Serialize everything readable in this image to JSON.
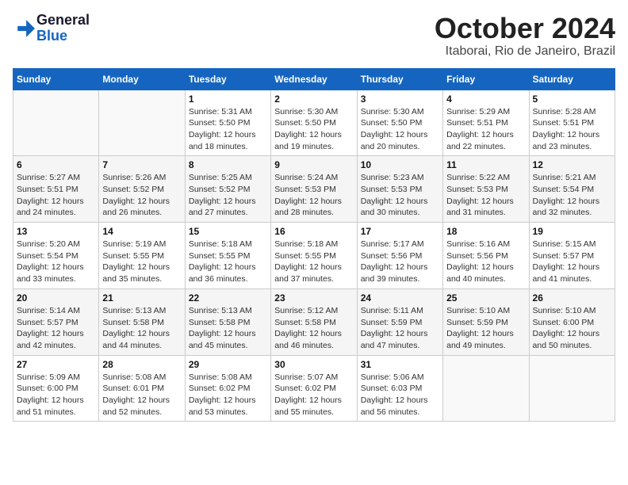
{
  "logo": {
    "line1": "General",
    "line2": "Blue"
  },
  "header": {
    "month": "October 2024",
    "location": "Itaborai, Rio de Janeiro, Brazil"
  },
  "weekdays": [
    "Sunday",
    "Monday",
    "Tuesday",
    "Wednesday",
    "Thursday",
    "Friday",
    "Saturday"
  ],
  "weeks": [
    [
      {
        "day": "",
        "sunrise": "",
        "sunset": "",
        "daylight": ""
      },
      {
        "day": "",
        "sunrise": "",
        "sunset": "",
        "daylight": ""
      },
      {
        "day": "1",
        "sunrise": "Sunrise: 5:31 AM",
        "sunset": "Sunset: 5:50 PM",
        "daylight": "Daylight: 12 hours and 18 minutes."
      },
      {
        "day": "2",
        "sunrise": "Sunrise: 5:30 AM",
        "sunset": "Sunset: 5:50 PM",
        "daylight": "Daylight: 12 hours and 19 minutes."
      },
      {
        "day": "3",
        "sunrise": "Sunrise: 5:30 AM",
        "sunset": "Sunset: 5:50 PM",
        "daylight": "Daylight: 12 hours and 20 minutes."
      },
      {
        "day": "4",
        "sunrise": "Sunrise: 5:29 AM",
        "sunset": "Sunset: 5:51 PM",
        "daylight": "Daylight: 12 hours and 22 minutes."
      },
      {
        "day": "5",
        "sunrise": "Sunrise: 5:28 AM",
        "sunset": "Sunset: 5:51 PM",
        "daylight": "Daylight: 12 hours and 23 minutes."
      }
    ],
    [
      {
        "day": "6",
        "sunrise": "Sunrise: 5:27 AM",
        "sunset": "Sunset: 5:51 PM",
        "daylight": "Daylight: 12 hours and 24 minutes."
      },
      {
        "day": "7",
        "sunrise": "Sunrise: 5:26 AM",
        "sunset": "Sunset: 5:52 PM",
        "daylight": "Daylight: 12 hours and 26 minutes."
      },
      {
        "day": "8",
        "sunrise": "Sunrise: 5:25 AM",
        "sunset": "Sunset: 5:52 PM",
        "daylight": "Daylight: 12 hours and 27 minutes."
      },
      {
        "day": "9",
        "sunrise": "Sunrise: 5:24 AM",
        "sunset": "Sunset: 5:53 PM",
        "daylight": "Daylight: 12 hours and 28 minutes."
      },
      {
        "day": "10",
        "sunrise": "Sunrise: 5:23 AM",
        "sunset": "Sunset: 5:53 PM",
        "daylight": "Daylight: 12 hours and 30 minutes."
      },
      {
        "day": "11",
        "sunrise": "Sunrise: 5:22 AM",
        "sunset": "Sunset: 5:53 PM",
        "daylight": "Daylight: 12 hours and 31 minutes."
      },
      {
        "day": "12",
        "sunrise": "Sunrise: 5:21 AM",
        "sunset": "Sunset: 5:54 PM",
        "daylight": "Daylight: 12 hours and 32 minutes."
      }
    ],
    [
      {
        "day": "13",
        "sunrise": "Sunrise: 5:20 AM",
        "sunset": "Sunset: 5:54 PM",
        "daylight": "Daylight: 12 hours and 33 minutes."
      },
      {
        "day": "14",
        "sunrise": "Sunrise: 5:19 AM",
        "sunset": "Sunset: 5:55 PM",
        "daylight": "Daylight: 12 hours and 35 minutes."
      },
      {
        "day": "15",
        "sunrise": "Sunrise: 5:18 AM",
        "sunset": "Sunset: 5:55 PM",
        "daylight": "Daylight: 12 hours and 36 minutes."
      },
      {
        "day": "16",
        "sunrise": "Sunrise: 5:18 AM",
        "sunset": "Sunset: 5:55 PM",
        "daylight": "Daylight: 12 hours and 37 minutes."
      },
      {
        "day": "17",
        "sunrise": "Sunrise: 5:17 AM",
        "sunset": "Sunset: 5:56 PM",
        "daylight": "Daylight: 12 hours and 39 minutes."
      },
      {
        "day": "18",
        "sunrise": "Sunrise: 5:16 AM",
        "sunset": "Sunset: 5:56 PM",
        "daylight": "Daylight: 12 hours and 40 minutes."
      },
      {
        "day": "19",
        "sunrise": "Sunrise: 5:15 AM",
        "sunset": "Sunset: 5:57 PM",
        "daylight": "Daylight: 12 hours and 41 minutes."
      }
    ],
    [
      {
        "day": "20",
        "sunrise": "Sunrise: 5:14 AM",
        "sunset": "Sunset: 5:57 PM",
        "daylight": "Daylight: 12 hours and 42 minutes."
      },
      {
        "day": "21",
        "sunrise": "Sunrise: 5:13 AM",
        "sunset": "Sunset: 5:58 PM",
        "daylight": "Daylight: 12 hours and 44 minutes."
      },
      {
        "day": "22",
        "sunrise": "Sunrise: 5:13 AM",
        "sunset": "Sunset: 5:58 PM",
        "daylight": "Daylight: 12 hours and 45 minutes."
      },
      {
        "day": "23",
        "sunrise": "Sunrise: 5:12 AM",
        "sunset": "Sunset: 5:58 PM",
        "daylight": "Daylight: 12 hours and 46 minutes."
      },
      {
        "day": "24",
        "sunrise": "Sunrise: 5:11 AM",
        "sunset": "Sunset: 5:59 PM",
        "daylight": "Daylight: 12 hours and 47 minutes."
      },
      {
        "day": "25",
        "sunrise": "Sunrise: 5:10 AM",
        "sunset": "Sunset: 5:59 PM",
        "daylight": "Daylight: 12 hours and 49 minutes."
      },
      {
        "day": "26",
        "sunrise": "Sunrise: 5:10 AM",
        "sunset": "Sunset: 6:00 PM",
        "daylight": "Daylight: 12 hours and 50 minutes."
      }
    ],
    [
      {
        "day": "27",
        "sunrise": "Sunrise: 5:09 AM",
        "sunset": "Sunset: 6:00 PM",
        "daylight": "Daylight: 12 hours and 51 minutes."
      },
      {
        "day": "28",
        "sunrise": "Sunrise: 5:08 AM",
        "sunset": "Sunset: 6:01 PM",
        "daylight": "Daylight: 12 hours and 52 minutes."
      },
      {
        "day": "29",
        "sunrise": "Sunrise: 5:08 AM",
        "sunset": "Sunset: 6:02 PM",
        "daylight": "Daylight: 12 hours and 53 minutes."
      },
      {
        "day": "30",
        "sunrise": "Sunrise: 5:07 AM",
        "sunset": "Sunset: 6:02 PM",
        "daylight": "Daylight: 12 hours and 55 minutes."
      },
      {
        "day": "31",
        "sunrise": "Sunrise: 5:06 AM",
        "sunset": "Sunset: 6:03 PM",
        "daylight": "Daylight: 12 hours and 56 minutes."
      },
      {
        "day": "",
        "sunrise": "",
        "sunset": "",
        "daylight": ""
      },
      {
        "day": "",
        "sunrise": "",
        "sunset": "",
        "daylight": ""
      }
    ]
  ]
}
